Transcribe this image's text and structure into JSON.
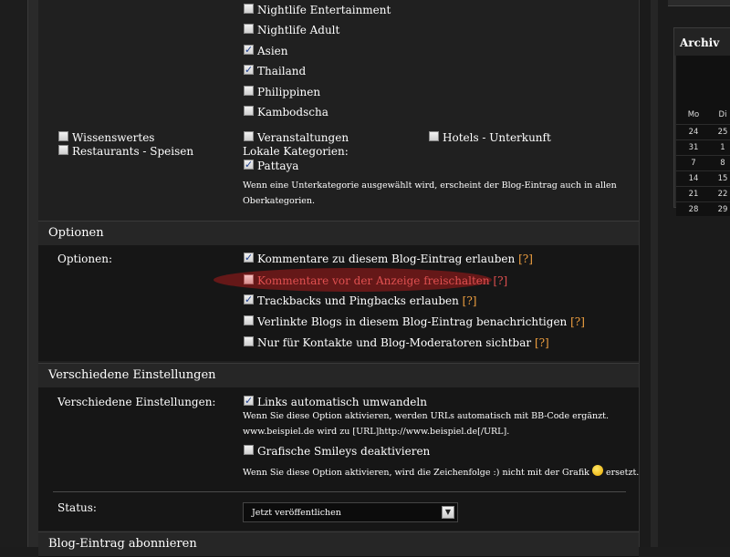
{
  "categories": {
    "top_list": [
      {
        "label": "Nightlife Entertainment",
        "checked": false
      },
      {
        "label": "Nightlife Adult",
        "checked": false
      },
      {
        "label": "Asien",
        "checked": true
      },
      {
        "label": "Thailand",
        "checked": true
      },
      {
        "label": "Philippinen",
        "checked": false
      },
      {
        "label": "Kambodscha",
        "checked": false
      }
    ],
    "wissenswertes": "Wissenswertes",
    "restaurants": "Restaurants - Speisen",
    "veranstaltungen": "Veranstaltungen",
    "hotels": "Hotels - Unterkunft",
    "lokale_heading": "Lokale Kategorien:",
    "pattaya": "Pattaya",
    "hint_line1": "Wenn eine Unterkategorie ausgewählt wird, erscheint der Blog-Eintrag auch in allen",
    "hint_line2": "Oberkategorien."
  },
  "optionen": {
    "heading": "Optionen",
    "row_label": "Optionen:",
    "items": [
      {
        "label": "Kommentare zu diesem Blog-Eintrag erlauben",
        "help": "[?]",
        "checked": true
      },
      {
        "label": "Kommentare vor der Anzeige freischalten",
        "help": "[?]",
        "checked": false
      },
      {
        "label": "Trackbacks und Pingbacks erlauben",
        "help": "[?]",
        "checked": true
      },
      {
        "label": "Verlinkte Blogs in diesem Blog-Eintrag benachrichtigen",
        "help": "[?]",
        "checked": false
      },
      {
        "label": "Nur für Kontakte und Blog-Moderatoren sichtbar",
        "help": "[?]",
        "checked": false
      }
    ]
  },
  "verschiedene": {
    "heading": "Verschiedene Einstellungen",
    "row_label": "Verschiedene Einstellungen:",
    "links_label": "Links automatisch umwandeln",
    "links_checked": true,
    "links_hint1": "Wenn Sie diese Option aktivieren, werden URLs automatisch mit BB-Code ergänzt.",
    "links_hint2": "www.beispiel.de wird zu [URL]http://www.beispiel.de[/URL].",
    "smileys_label": "Grafische Smileys deaktivieren",
    "smileys_checked": false,
    "smileys_hint_before": "Wenn Sie diese Option aktivieren, wird die Zeichenfolge :) nicht mit der Grafik",
    "smileys_hint_after": "ersetzt.",
    "status_label": "Status:",
    "status_value": "Jetzt veröffentlichen"
  },
  "abonnieren": {
    "heading": "Blog-Eintrag abonnieren"
  },
  "archive": {
    "title": "Archiv",
    "weekday_mo": "Mo",
    "weekday_di": "Di",
    "col_mo": [
      "24",
      "31",
      "7",
      "14",
      "21",
      "28"
    ],
    "col_di": [
      "25",
      "1",
      "8",
      "15",
      "22",
      "29"
    ]
  },
  "colors": {
    "help_link": "#f0a040",
    "highlight": "#6e1818",
    "background": "#1c1c1c"
  }
}
